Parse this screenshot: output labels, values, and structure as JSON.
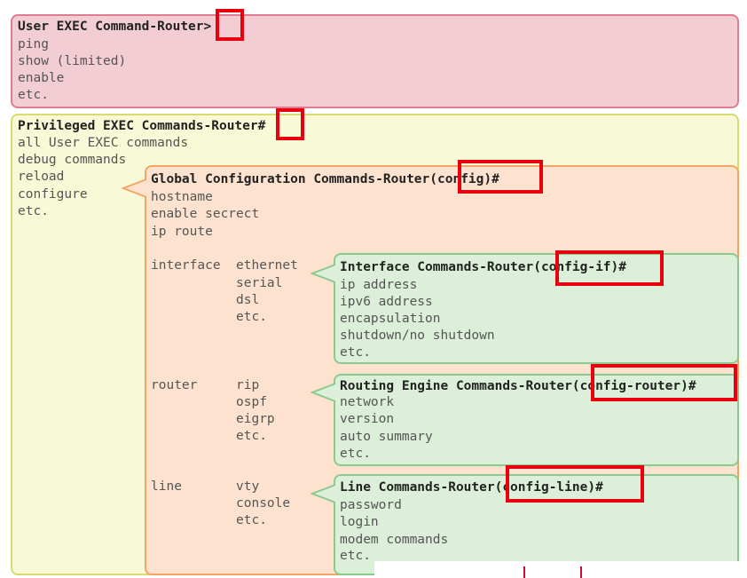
{
  "user_exec": {
    "header": "User EXEC Command-Router>",
    "items": [
      "ping",
      "show (limited)",
      "enable",
      "etc."
    ]
  },
  "privileged_exec": {
    "header": "Privileged EXEC Commands-Router#",
    "items": [
      "all User EXEC commands",
      "debug commands",
      "reload",
      "configure",
      "etc."
    ]
  },
  "global_config": {
    "header": "Global Configuration Commands-Router(config)#",
    "items": [
      "hostname",
      "enable secrect",
      "ip route"
    ],
    "interface_group": {
      "label": "interface",
      "options": [
        "ethernet",
        "serial",
        "dsl",
        "etc."
      ]
    },
    "router_group": {
      "label": "router",
      "options": [
        "rip",
        "ospf",
        "eigrp",
        "etc."
      ]
    },
    "line_group": {
      "label": "line",
      "options": [
        "vty",
        "console",
        "etc."
      ]
    }
  },
  "interface_cmds": {
    "header": "Interface Commands-Router(config-if)#",
    "items": [
      "ip address",
      "ipv6 address",
      "encapsulation",
      "shutdown/no shutdown",
      "etc."
    ]
  },
  "routing_cmds": {
    "header": "Routing Engine Commands-Router(config-router)#",
    "items": [
      "network",
      "version",
      "auto summary",
      "etc."
    ]
  },
  "line_cmds": {
    "header": "Line Commands-Router(config-line)#",
    "items": [
      "password",
      "login",
      "modem commands",
      "etc."
    ]
  },
  "colors": {
    "user_fill": "#f3cdd4",
    "user_border": "#e07b91",
    "priv_fill": "#f8f9d6",
    "priv_border": "#d7dc6e",
    "global_fill": "#fde3cf",
    "global_border": "#f4a566",
    "sub_fill": "#dcefd9",
    "sub_border": "#8cc98e",
    "highlight": "#e8000f"
  }
}
